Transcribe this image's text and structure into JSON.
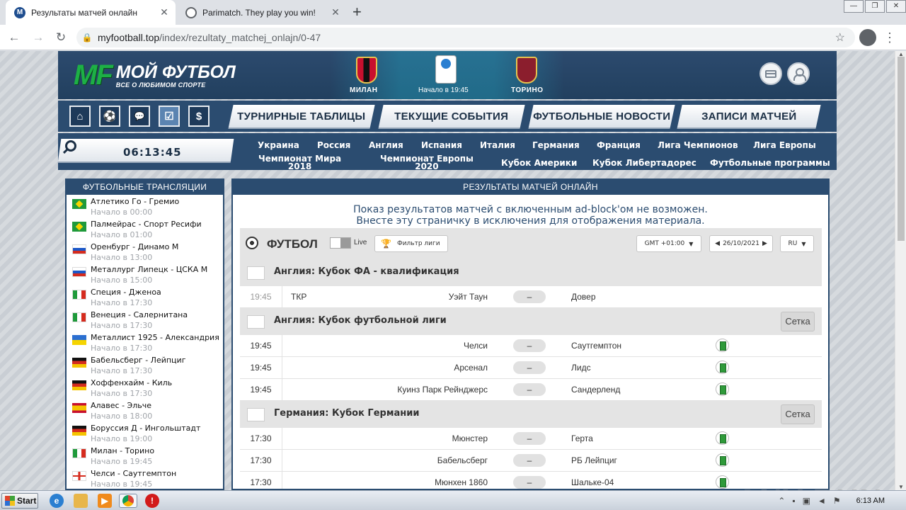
{
  "browser": {
    "tabs": [
      {
        "title": "Результаты матчей онлайн",
        "favicon": "M"
      },
      {
        "title": "Parimatch. They play you win!"
      }
    ],
    "close_glyph": "✕",
    "new_tab_glyph": "+",
    "window_controls": [
      "—",
      "❐",
      "✕"
    ],
    "nav": {
      "back": "←",
      "forward": "→",
      "reload": "↻"
    },
    "url_host": "myfootball.top",
    "url_path": "/index/rezultaty_matchej_onlajn/0-47",
    "star": "☆",
    "menu": "⋮"
  },
  "header": {
    "logo_mark": "MF",
    "logo_name": "МОЙ ФУТБОЛ",
    "logo_tagline": "ВСЕ О ЛЮБИМОМ СПОРТЕ",
    "banner": {
      "home_team": "МИЛАН",
      "away_team": "ТОРИНО",
      "kickoff": "Начало в 19:45"
    },
    "icons": [
      "card-icon",
      "user-icon"
    ]
  },
  "nav": {
    "icon_buttons": [
      {
        "glyph": "⌂",
        "name": "home-icon"
      },
      {
        "glyph": "⚽",
        "name": "ball-icon"
      },
      {
        "glyph": "💬",
        "name": "chat-icon"
      },
      {
        "glyph": "☑",
        "name": "checklist-icon"
      },
      {
        "glyph": "$",
        "name": "dollar-icon"
      }
    ],
    "menu": [
      "ТУРНИРНЫЕ ТАБЛИЦЫ",
      "ТЕКУЩИЕ СОБЫТИЯ",
      "ФУТБОЛЬНЫЕ НОВОСТИ",
      "ЗАПИСИ МАТЧЕЙ"
    ]
  },
  "clock": "06:13:45",
  "leagues": {
    "row1": [
      "Украина",
      "Россия",
      "Англия",
      "Испания",
      "Италия",
      "Германия",
      "Франция",
      "Лига Чемпионов",
      "Лига Европы"
    ],
    "row2": [
      "Кубок Америки",
      "Кубок Либертадорес",
      "Футбольные программы"
    ],
    "special": [
      {
        "line1": "Чемпионат Мира",
        "line2": "2018"
      },
      {
        "line1": "Чемпионат Европы",
        "line2": "2020"
      }
    ]
  },
  "sidebar": {
    "title": "ФУТБОЛЬНЫЕ ТРАНСЛЯЦИИ",
    "items": [
      {
        "match": "Атлетико Го - Гремио",
        "time": "Начало в 00:00",
        "flag": "br"
      },
      {
        "match": "Палмейрас - Спорт Ресифи",
        "time": "Начало в 01:00",
        "flag": "br"
      },
      {
        "match": "Оренбург - Динамо М",
        "time": "Начало в 13:00",
        "flag": "ru"
      },
      {
        "match": "Металлург Липецк - ЦСКА М",
        "time": "Начало в 15:00",
        "flag": "ru"
      },
      {
        "match": "Специя - Дженоа",
        "time": "Начало в 17:30",
        "flag": "it"
      },
      {
        "match": "Венеция - Салернитана",
        "time": "Начало в 17:30",
        "flag": "it"
      },
      {
        "match": "Металлист 1925 - Александрия",
        "time": "Начало в 17:30",
        "flag": "ua"
      },
      {
        "match": "Бабельсберг - Лейпциг",
        "time": "Начало в 17:30",
        "flag": "de"
      },
      {
        "match": "Хоффенхайм - Киль",
        "time": "Начало в 17:30",
        "flag": "de"
      },
      {
        "match": "Алавес - Эльче",
        "time": "Начало в 18:00",
        "flag": "es"
      },
      {
        "match": "Боруссия Д - Ингольштадт",
        "time": "Начало в 19:00",
        "flag": "de"
      },
      {
        "match": "Милан - Торино",
        "time": "Начало в 19:45",
        "flag": "it"
      },
      {
        "match": "Челси - Саутгемптон",
        "time": "Начало в 19:45",
        "flag": "en"
      }
    ]
  },
  "main": {
    "title": "РЕЗУЛЬТАТЫ МАТЧЕЙ ОНЛАЙН",
    "notice_line1": "Показ результатов матчей с включенным ad-block'ом не возможен.",
    "notice_line2": "Внесте эту страничку в исключения для отображения материала.",
    "sport": "ФУТБОЛ",
    "live_label": "Live",
    "filter_label": "Фильтр лиги",
    "timezone": "GMT +01:00",
    "date": "26/10/2021",
    "lang": "RU",
    "bracket_label": "Сетка",
    "competitions": [
      {
        "name": "Англия:  Кубок ФА - квалификация",
        "bracket": false,
        "matches": [
          {
            "time": "19:45",
            "extra": "ТКР",
            "home": "Уэйт Таун",
            "score": "–",
            "away": "Довер",
            "field": false
          }
        ]
      },
      {
        "name": "Англия:  Кубок футбольной лиги",
        "bracket": true,
        "matches": [
          {
            "time": "19:45",
            "home": "Челси",
            "score": "–",
            "away": "Саутгемптон",
            "field": true
          },
          {
            "time": "19:45",
            "home": "Арсенал",
            "score": "–",
            "away": "Лидс",
            "field": true
          },
          {
            "time": "19:45",
            "home": "Куинз Парк Рейнджерс",
            "score": "–",
            "away": "Сандерленд",
            "field": true
          }
        ]
      },
      {
        "name": "Германия:  Кубок Германии",
        "bracket": true,
        "matches": [
          {
            "time": "17:30",
            "home": "Мюнстер",
            "score": "–",
            "away": "Герта",
            "field": true
          },
          {
            "time": "17:30",
            "home": "Бабельсберг",
            "score": "–",
            "away": "РБ Лейпциг",
            "field": true
          },
          {
            "time": "17:30",
            "home": "Мюнхен 1860",
            "score": "–",
            "away": "Шальке-04",
            "field": true
          }
        ]
      }
    ]
  },
  "watermark": "ANY RUN",
  "taskbar": {
    "start": "Start",
    "tray_time": "6:13 AM"
  }
}
